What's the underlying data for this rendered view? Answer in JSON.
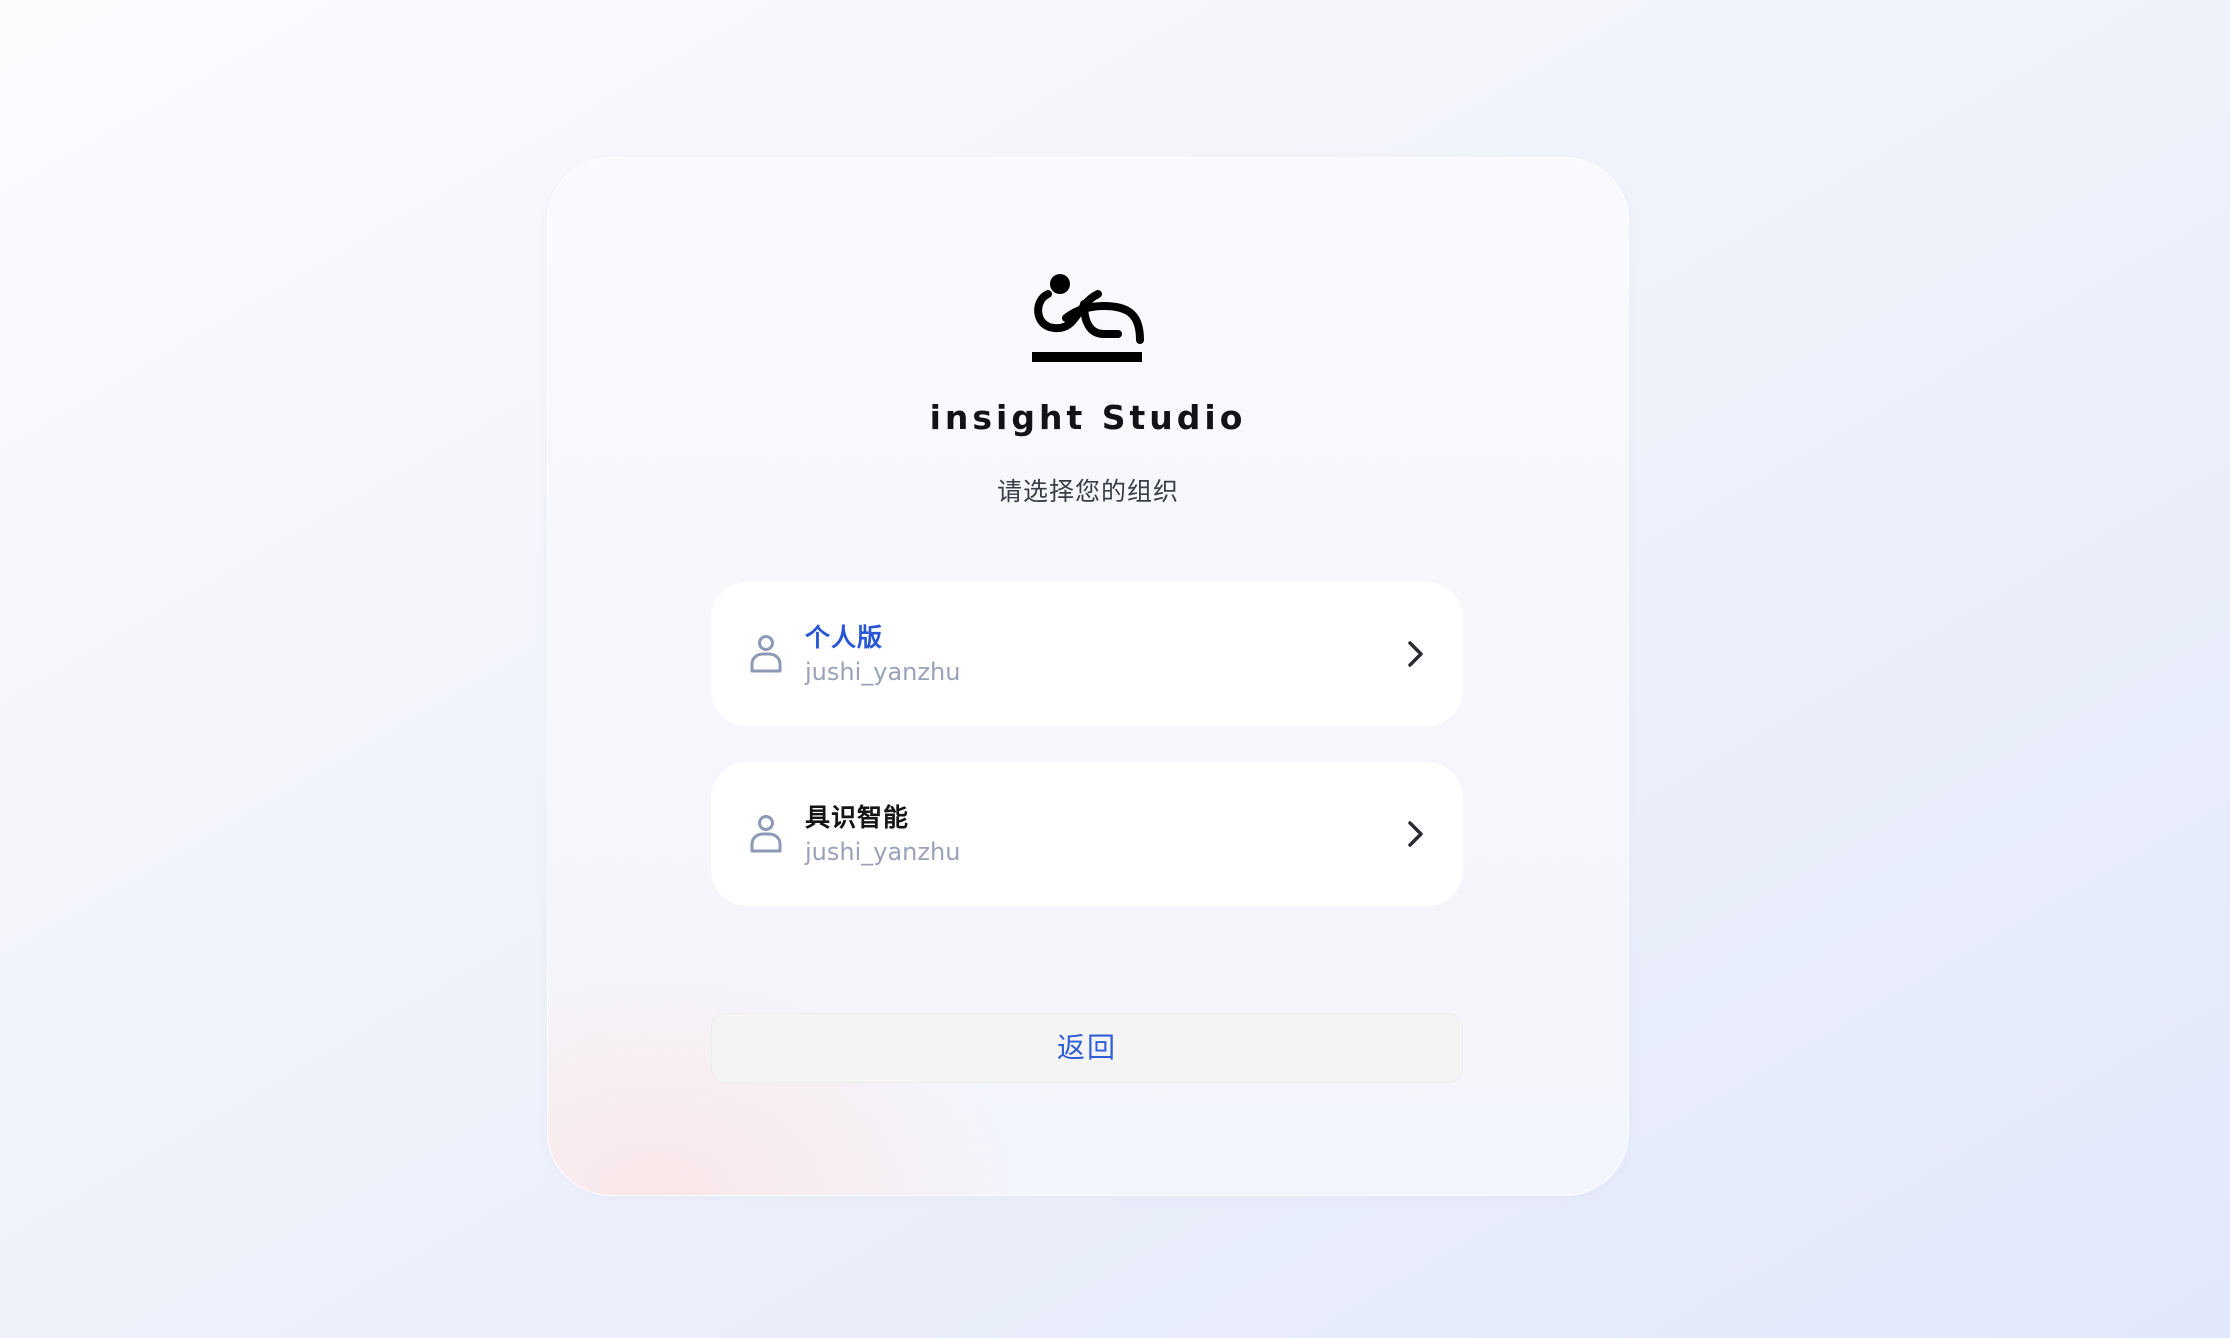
{
  "brand": {
    "logo_icon": "insight-studio-logo-icon",
    "name": "insight Studio"
  },
  "prompt": "请选择您的组织",
  "organizations": [
    {
      "name": "个人版",
      "username": "jushi_yanzhu",
      "icon": "person-icon",
      "highlighted": true,
      "name_color": "#2856d6"
    },
    {
      "name": "具识智能",
      "username": "jushi_yanzhu",
      "icon": "person-icon",
      "highlighted": false,
      "name_color": "#141414"
    }
  ],
  "back_button": {
    "label": "返回",
    "color": "#2f5ed8"
  },
  "colors": {
    "accent": "#2856d6",
    "muted_text": "#9aa1b8",
    "icon": "#8e99b6"
  }
}
